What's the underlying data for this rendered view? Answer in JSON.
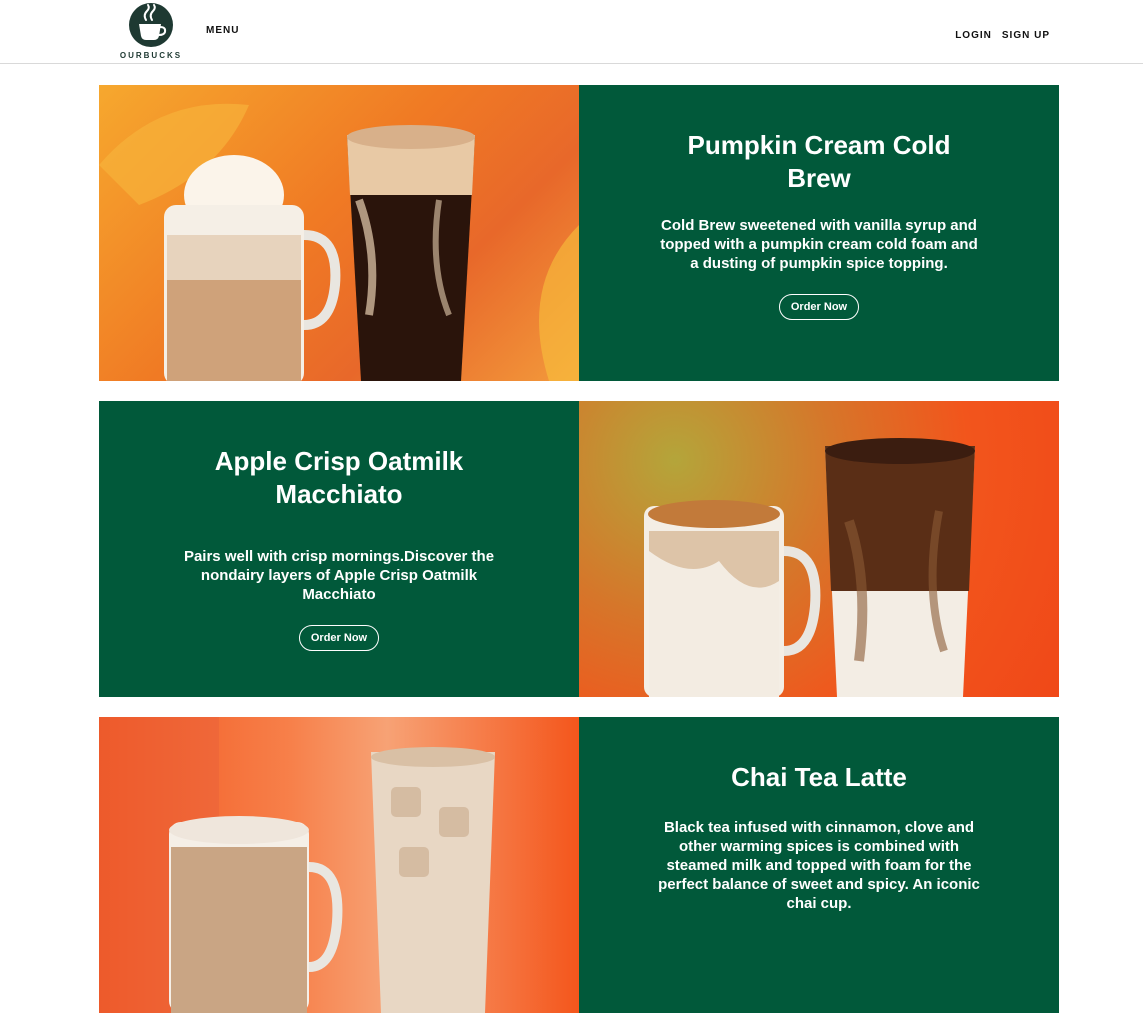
{
  "header": {
    "logo_text": "OURBUCKS",
    "menu_label": "MENU",
    "login_label": "LOGIN",
    "signup_label": "SIGN UP"
  },
  "cards": [
    {
      "title": "Pumpkin Cream Cold Brew",
      "description": "Cold Brew sweetened with vanilla syrup and topped with a pumpkin cream cold foam and a dusting of pumpkin spice topping.",
      "button": "Order Now"
    },
    {
      "title": "Apple Crisp Oatmilk Macchiato",
      "description": "Pairs well with crisp mornings.Discover the nondairy layers of Apple Crisp Oatmilk Macchiato",
      "button": "Order Now"
    },
    {
      "title": "Chai Tea Latte",
      "description": "Black tea infused with cinnamon, clove and other warming spices is combined with steamed milk and topped with foam for the perfect balance of sweet and spicy. An iconic chai cup."
    }
  ],
  "colors": {
    "panel_green": "#01593a",
    "logo_dark": "#1e3932"
  }
}
